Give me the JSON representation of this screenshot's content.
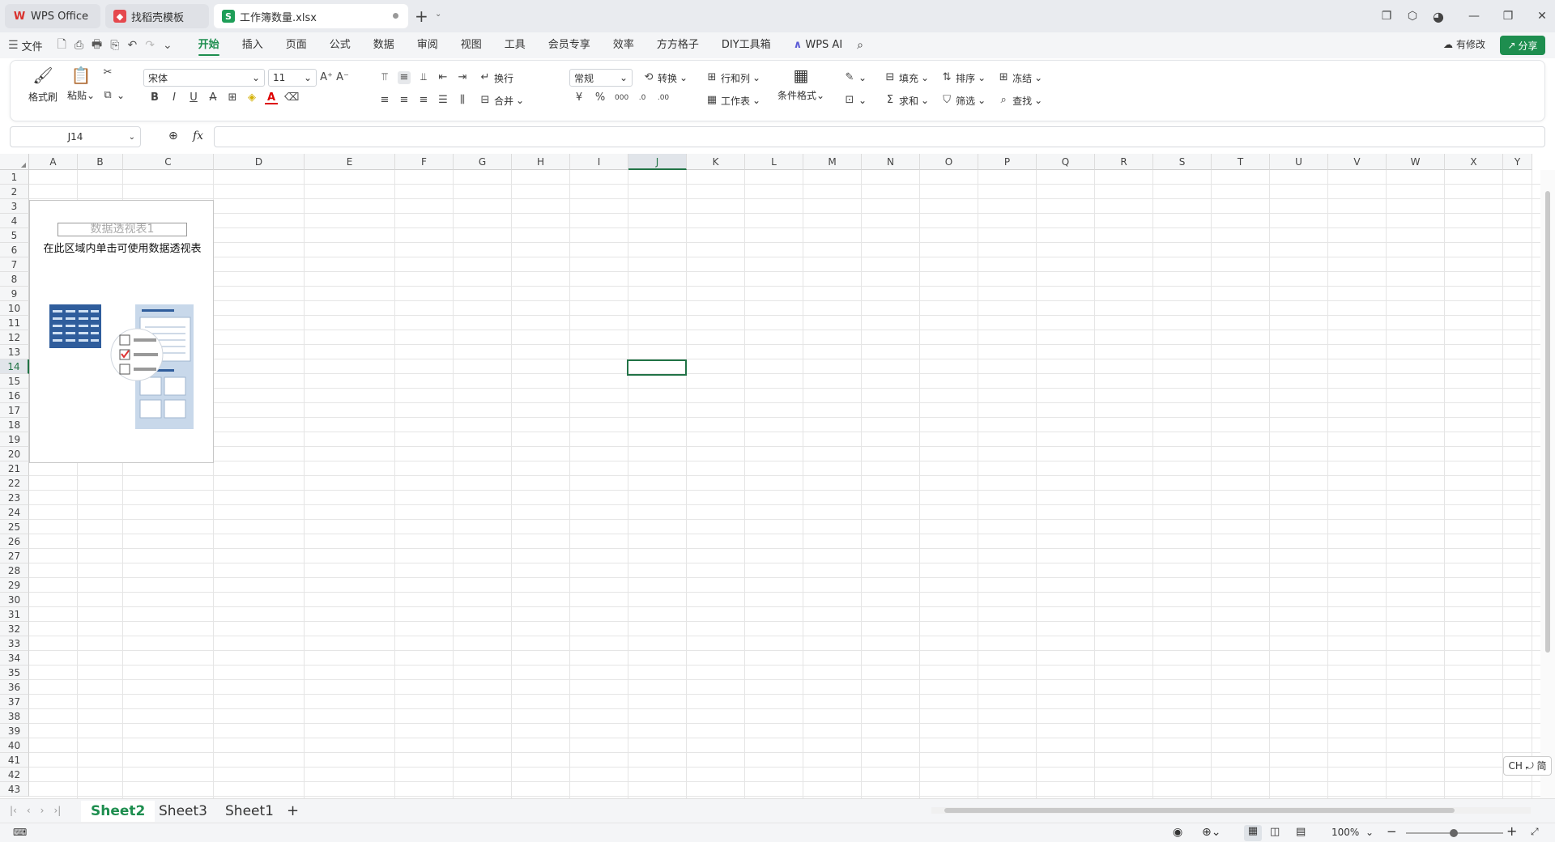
{
  "tabs": [
    {
      "label": "WPS Office",
      "icon": "wps-logo-icon"
    },
    {
      "label": "找稻壳模板",
      "icon": "docer-icon"
    },
    {
      "label": "工作簿数量.xlsx",
      "icon": "sheet-s-icon"
    }
  ],
  "menu": {
    "file": "文件",
    "items": [
      "开始",
      "插入",
      "页面",
      "公式",
      "数据",
      "审阅",
      "视图",
      "工具",
      "会员专享",
      "效率",
      "方方格子",
      "DIY工具箱"
    ],
    "wps_ai": "WPS AI",
    "status": "有修改",
    "share": "分享"
  },
  "ribbon": {
    "format_painter": "格式刷",
    "paste": "粘贴",
    "font_name": "宋体",
    "font_size": "11",
    "wrap": "换行",
    "merge": "合并",
    "number_format": "常规",
    "convert": "转换",
    "row_col": "行和列",
    "worksheet": "工作表",
    "cond_format": "条件格式",
    "fill": "填充",
    "sort": "排序",
    "freeze": "冻结",
    "sum": "求和",
    "filter": "筛选",
    "find": "查找"
  },
  "formula": {
    "namebox": "J14",
    "fx": "fx"
  },
  "columns": [
    "A",
    "B",
    "C",
    "D",
    "E",
    "F",
    "G",
    "H",
    "I",
    "J",
    "K",
    "L",
    "M",
    "N",
    "O",
    "P",
    "Q",
    "R",
    "S",
    "T",
    "U",
    "V",
    "W",
    "X",
    "Y"
  ],
  "rows": [
    "1",
    "2",
    "3",
    "4",
    "5",
    "6",
    "7",
    "8",
    "9",
    "10",
    "11",
    "12",
    "13",
    "14",
    "15",
    "16",
    "17",
    "18",
    "19",
    "20",
    "21",
    "22",
    "23",
    "24",
    "25",
    "26",
    "27",
    "28",
    "29",
    "30",
    "31",
    "32",
    "33",
    "34",
    "35",
    "36",
    "37",
    "38",
    "39",
    "40",
    "41",
    "42",
    "43"
  ],
  "pivot": {
    "name": "数据透视表1",
    "hint": "在此区域内单击可使用数据透视表"
  },
  "sheets": [
    "Sheet2",
    "Sheet3",
    "Sheet1"
  ],
  "active_sheet": "Sheet2",
  "status": {
    "zoom": "100%",
    "ime": "CH ⤾ 简"
  },
  "colors": {
    "accent": "#1e8e4f",
    "selection": "#217346"
  }
}
